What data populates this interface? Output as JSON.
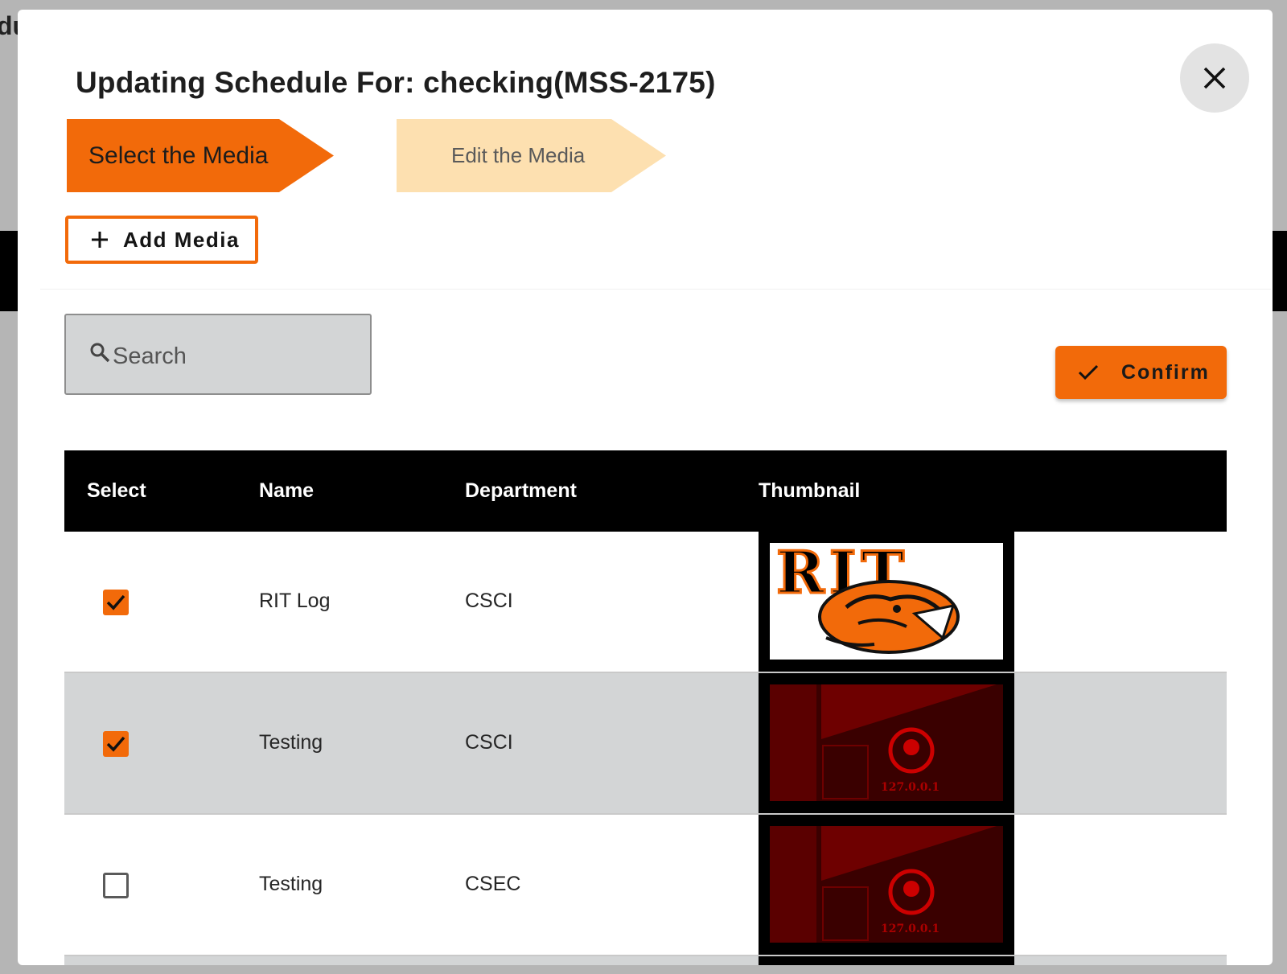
{
  "dialog": {
    "title": "Updating Schedule For: checking(MSS-2175)",
    "close_icon": "close-icon"
  },
  "steps": [
    {
      "label": "Select the Media",
      "state": "active",
      "color": "#f26a0a"
    },
    {
      "label": "Edit the Media",
      "state": "inactive",
      "color": "#fde0b0"
    }
  ],
  "toolbar": {
    "add_label": "Add Media",
    "confirm_label": "Confirm"
  },
  "search": {
    "placeholder": "Search",
    "value": ""
  },
  "table": {
    "headers": [
      "Select",
      "Name",
      "Department",
      "Thumbnail"
    ],
    "rows": [
      {
        "selected": true,
        "name": "RIT Log",
        "department": "CSCI",
        "thumbnail": "RIT"
      },
      {
        "selected": true,
        "name": "Testing",
        "department": "CSCI",
        "thumbnail": "127.0.0.1"
      },
      {
        "selected": false,
        "name": "Testing",
        "department": "CSEC",
        "thumbnail": "127.0.0.1"
      }
    ]
  },
  "backdrop": {
    "partial_text": "du"
  },
  "colors": {
    "accent": "#f26a0a",
    "step_inactive": "#fde0b0",
    "header_bg": "#000000",
    "alt_row": "#d3d5d6"
  }
}
